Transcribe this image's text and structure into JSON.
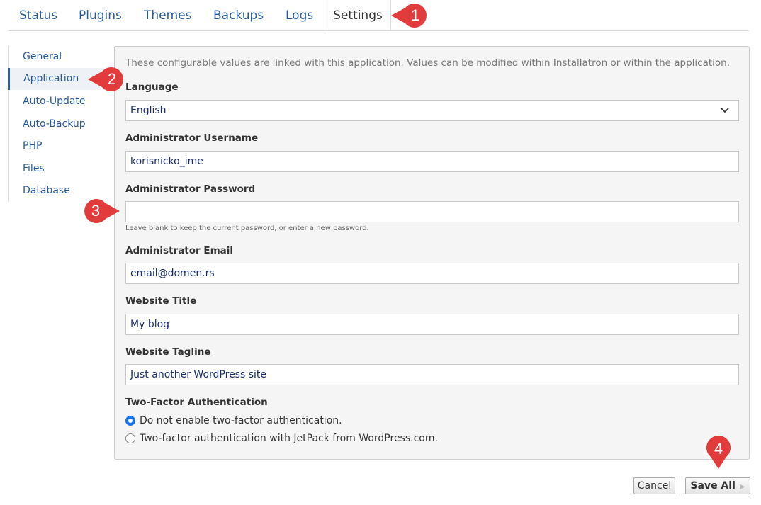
{
  "tabs": [
    {
      "label": "Status"
    },
    {
      "label": "Plugins"
    },
    {
      "label": "Themes"
    },
    {
      "label": "Backups"
    },
    {
      "label": "Logs"
    },
    {
      "label": "Settings",
      "active": true
    }
  ],
  "sidebar": {
    "items": [
      {
        "label": "General"
      },
      {
        "label": "Application",
        "active": true
      },
      {
        "label": "Auto-Update"
      },
      {
        "label": "Auto-Backup"
      },
      {
        "label": "PHP"
      },
      {
        "label": "Files"
      },
      {
        "label": "Database"
      }
    ]
  },
  "form": {
    "intro": "These configurable values are linked with this application. Values can be modified within Installatron or within the application.",
    "language": {
      "label": "Language",
      "value": "English"
    },
    "admin_username": {
      "label": "Administrator Username",
      "value": "korisnicko_ime"
    },
    "admin_password": {
      "label": "Administrator Password",
      "value": "",
      "help": "Leave blank to keep the current password, or enter a new password."
    },
    "admin_email": {
      "label": "Administrator Email",
      "value": "email@domen.rs"
    },
    "website_title": {
      "label": "Website Title",
      "value": "My blog"
    },
    "website_tagline": {
      "label": "Website Tagline",
      "value": "Just another WordPress site"
    },
    "two_factor": {
      "label": "Two-Factor Authentication",
      "options": [
        {
          "label": "Do not enable two-factor authentication.",
          "checked": true
        },
        {
          "label": "Two-factor authentication with JetPack from WordPress.com.",
          "checked": false
        }
      ]
    }
  },
  "buttons": {
    "cancel": "Cancel",
    "save_all": "Save All"
  },
  "callouts": [
    "1",
    "2",
    "3",
    "4"
  ],
  "colors": {
    "accent": "#1a73e8",
    "link": "#2a5b9a",
    "callout": "#e23b3b"
  }
}
